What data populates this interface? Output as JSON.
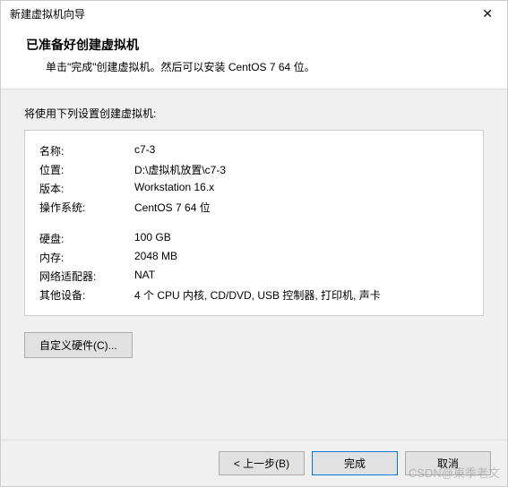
{
  "titlebar": {
    "title": "新建虚拟机向导"
  },
  "header": {
    "heading": "已准备好创建虚拟机",
    "sub": "单击\"完成\"创建虚拟机。然后可以安装 CentOS 7 64 位。"
  },
  "content": {
    "label": "将使用下列设置创建虚拟机:",
    "rows1": [
      {
        "label": "名称:",
        "value": "c7-3"
      },
      {
        "label": "位置:",
        "value": "D:\\虚拟机放置\\c7-3"
      },
      {
        "label": "版本:",
        "value": "Workstation 16.x"
      },
      {
        "label": "操作系统:",
        "value": "CentOS 7 64 位"
      }
    ],
    "rows2": [
      {
        "label": "硬盘:",
        "value": "100 GB"
      },
      {
        "label": "内存:",
        "value": "2048 MB"
      },
      {
        "label": "网络适配器:",
        "value": "NAT"
      },
      {
        "label": "其他设备:",
        "value": "4 个 CPU 内核, CD/DVD, USB 控制器, 打印机, 声卡"
      }
    ],
    "customize_label": "自定义硬件(C)..."
  },
  "footer": {
    "back": "< 上一步(B)",
    "finish": "完成",
    "cancel": "取消"
  },
  "watermark": "CSDN@東季老文"
}
